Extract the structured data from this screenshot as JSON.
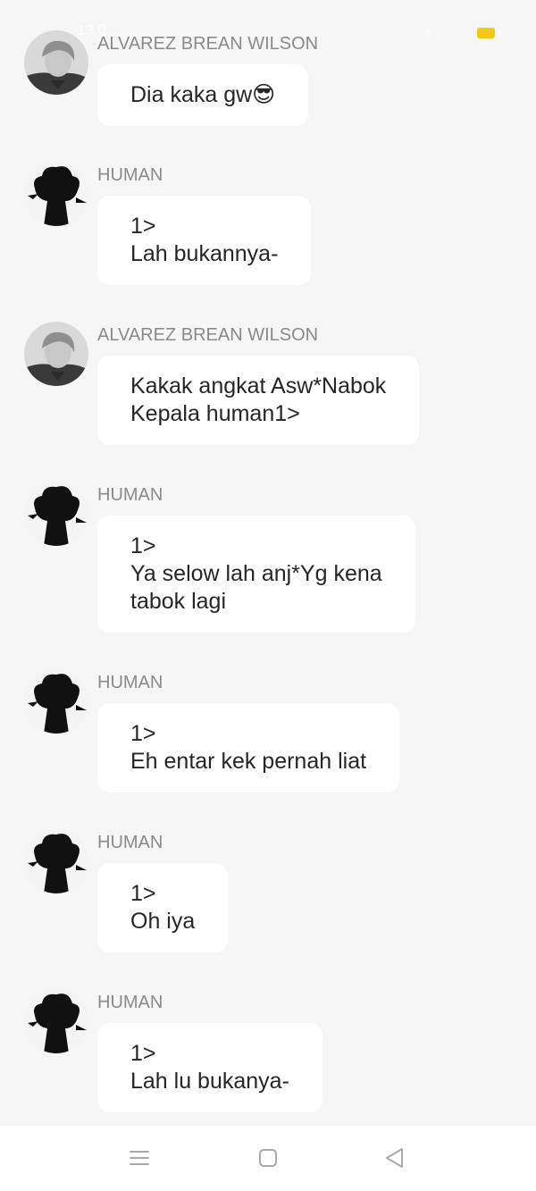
{
  "status_bar": {
    "time": "13.0…",
    "icons_text": "·· ≈ ·"
  },
  "messages": [
    {
      "sender": "ALVAREZ BREAN WILSON",
      "avatar": "photo-avatar",
      "lines": [
        "Dia kaka  gw😎"
      ]
    },
    {
      "sender": "HUMAN",
      "avatar": "silhouette-avatar",
      "lines": [
        "1>",
        "Lah bukannya-"
      ]
    },
    {
      "sender": "ALVAREZ BREAN WILSON",
      "avatar": "photo-avatar",
      "lines": [
        "Kakak angkat Asw*Nabok",
        "Kepala human1>"
      ]
    },
    {
      "sender": "HUMAN",
      "avatar": "silhouette-avatar",
      "lines": [
        "1>",
        "Ya selow lah anj*Yg kena",
        "tabok lagi"
      ]
    },
    {
      "sender": "HUMAN",
      "avatar": "silhouette-avatar",
      "lines": [
        "1>",
        "Eh entar kek pernah liat"
      ]
    },
    {
      "sender": "HUMAN",
      "avatar": "silhouette-avatar",
      "lines": [
        "1>",
        "Oh iya"
      ]
    },
    {
      "sender": "HUMAN",
      "avatar": "silhouette-avatar",
      "lines": [
        "1>",
        "Lah lu bukanya-"
      ]
    }
  ],
  "nav_bar": {
    "buttons": [
      "menu-icon",
      "home-square-icon",
      "back-triangle-icon"
    ]
  }
}
